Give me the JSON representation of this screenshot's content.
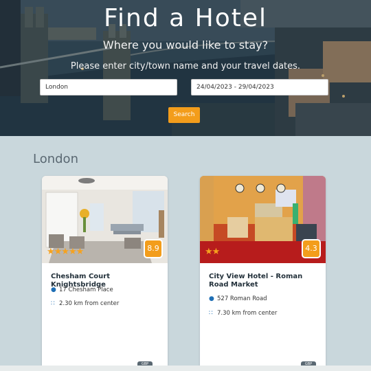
{
  "hero": {
    "title": "Find a Hotel",
    "subtitle": "Where you would like to stay?",
    "instruction": "Please enter city/town name and your travel dates."
  },
  "search": {
    "city_value": "London",
    "dates_value": "24/04/2023 - 29/04/2023",
    "button_label": "Search"
  },
  "results": {
    "city_heading": "London",
    "hotels": [
      {
        "name": "Chesham Court Knightsbridge",
        "address": "17 Chesham Place",
        "distance": "2.30 km from center",
        "score": "8.9",
        "stars": 5,
        "stars_text": "★★★★★",
        "currency_badge": "GBP"
      },
      {
        "name": "City View Hotel - Roman Road Market",
        "address": "527 Roman Road",
        "distance": "7.30 km from center",
        "score": "4.3",
        "stars": 2,
        "stars_text": "★★",
        "currency_badge": "GBP"
      }
    ]
  },
  "icons": {
    "address": "map-pin-icon",
    "distance": "route-icon"
  },
  "colors": {
    "accent": "#f39d1b",
    "page_bg": "#c9d7dc",
    "title_text": "#5a6872",
    "icon_blue": "#1f6fb5"
  }
}
